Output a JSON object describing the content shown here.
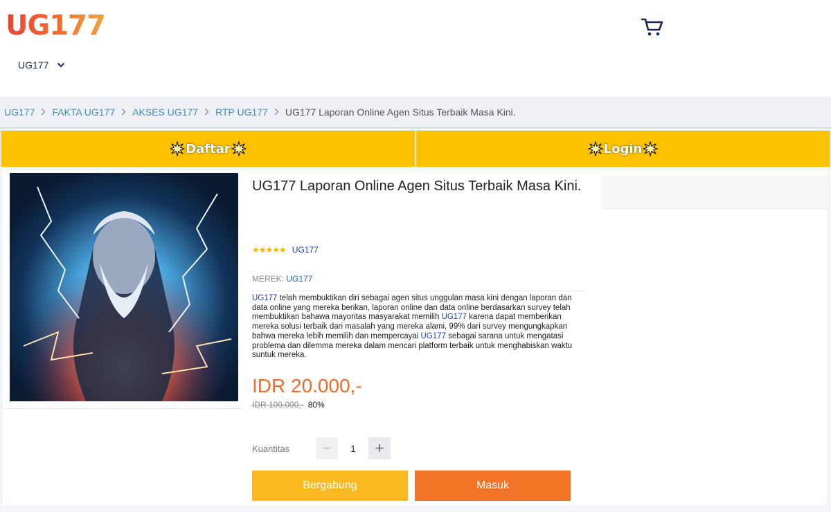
{
  "header": {
    "logo_text": "UG177",
    "nav_dropdown_label": "UG177"
  },
  "breadcrumb": {
    "items": [
      "UG177",
      "FAKTA UG177",
      "AKSES UG177",
      "RTP UG177"
    ],
    "current": "UG177 Laporan Online Agen Situs Terbaik Masa Kini."
  },
  "cta": {
    "register_label": "Daftar",
    "login_label": "Login"
  },
  "product": {
    "title": "UG177 Laporan Online Agen Situs Terbaik Masa Kini.",
    "rating_stars": 5,
    "stars_text": "★★★★★",
    "shop_name": "UG177",
    "brand_prefix": "MEREK: ",
    "brand": "UG177",
    "desc_parts": [
      "UG177",
      " telah membuktikan diri sebagai agen situs unggulan masa kini dengan laporan dan data online yang mereka berikan, laporan online dan data online berdasarkan survey telah membuktikan bahawa mayoritas masyarakat memilih ",
      "UG177",
      " karena dapat memberikan mereka solusi terbaik dari masalah yang mereka alami, 99% dari survey mengungkapkan bahwa mereka lebih memilih dan mempercayai ",
      "UG177",
      " sebagai sarana untuk mengatasi problema dan dilemma mereka dalam mencari platform terbaik untuk menghabiskan waktu suntuk mereka."
    ],
    "price": "IDR 20.000,-",
    "old_price": "IDR 100.000,-",
    "discount": "80%",
    "quantity_label": "Kuantitas",
    "quantity_value": "1",
    "minus_symbol": "−",
    "plus_symbol": "+",
    "join_button": "Bergabung",
    "enter_button": "Masuk"
  },
  "colors": {
    "accent_orange": "#ef6b2a",
    "cta_yellow": "#fcc200",
    "join_yellow": "#fbb91f",
    "enter_orange": "#f27226",
    "link_blue": "#1d3fb0"
  },
  "icons": [
    "cart-icon",
    "chevron-down-icon",
    "chevron-right-icon",
    "burst-icon"
  ]
}
